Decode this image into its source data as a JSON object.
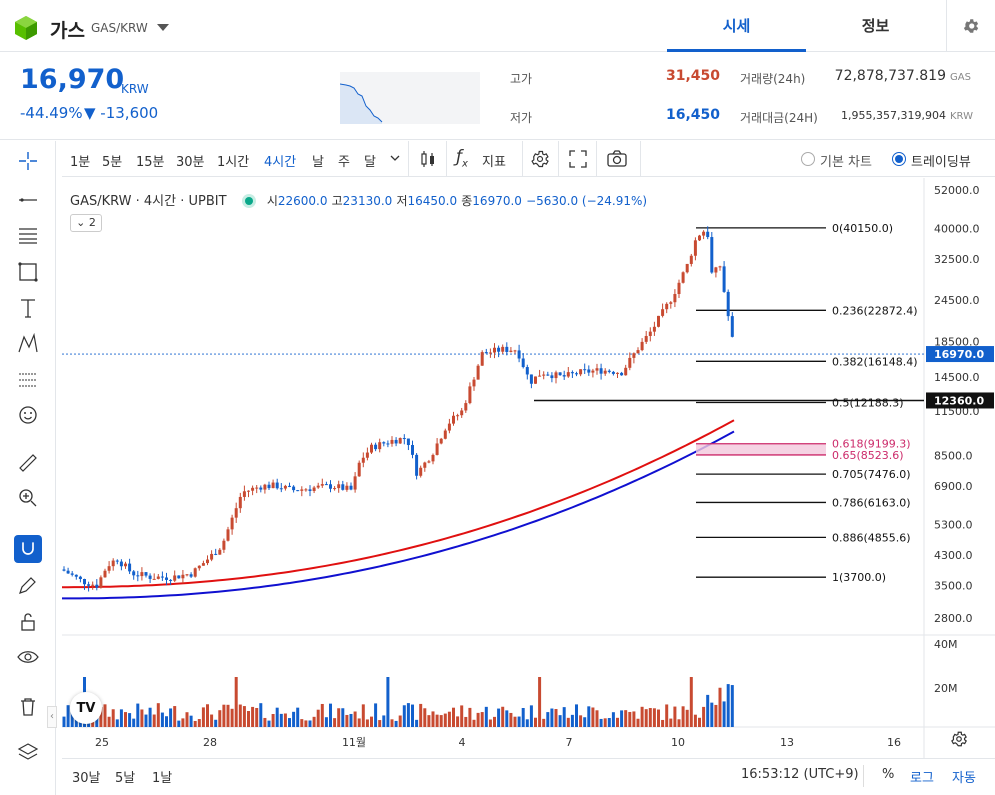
{
  "header": {
    "coin_name": "가스",
    "coin_pair": "GAS/KRW",
    "tabs": [
      "시세",
      "정보"
    ]
  },
  "summary": {
    "price": "16,970",
    "unit": "KRW",
    "change_pct": "-44.49%",
    "change_abs": "▼ -13,600",
    "high_label": "고가",
    "high_value": "31,450",
    "low_label": "저가",
    "low_value": "16,450",
    "volume_label": "거래량(24h)",
    "volume_value": "72,878,737.819",
    "volume_unit": "GAS",
    "amount_label": "거래대금(24H)",
    "amount_value": "1,955,357,319,904",
    "amount_unit": "KRW"
  },
  "toolbar": {
    "timeframes": [
      "1분",
      "5분",
      "15분",
      "30분",
      "1시간",
      "4시간",
      "날",
      "주",
      "달"
    ],
    "active_timeframe": "4시간",
    "indicator_label": "지표",
    "view_basic": "기본 차트",
    "view_tv": "트레이딩뷰"
  },
  "legend": {
    "symbol": "GAS/KRW · 4시간 · UPBIT",
    "o_label": "시",
    "o": "22600.0",
    "h_label": "고",
    "h": "23130.0",
    "l_label": "저",
    "l": "16450.0",
    "c_label": "종",
    "c": "16970.0",
    "chg": "−5630.0 (−24.91%)",
    "collapse": "2"
  },
  "colors": {
    "up": "#c84a31",
    "down": "#1260cc",
    "ma_red": "#e01010",
    "ma_blue": "#1010d0"
  },
  "chart_data": {
    "type": "candlestick",
    "price_axis": [
      "52000.0",
      "40000.0",
      "32500.0",
      "24500.0",
      "18500.0",
      "14500.0",
      "11500.0",
      "8500.0",
      "6900.0",
      "5300.0",
      "4300.0",
      "3500.0",
      "2800.0"
    ],
    "price_axis_values": [
      52000,
      40000,
      32500,
      24500,
      18500,
      14500,
      11500,
      8500,
      6900,
      5300,
      4300,
      3500,
      2800
    ],
    "volume_axis": [
      "40M",
      "20M"
    ],
    "x_ticks": [
      "25",
      "28",
      "11월",
      "4",
      "7",
      "10",
      "13",
      "16"
    ],
    "current_price_label": "16970.0",
    "crosshair_price_label": "12360.0",
    "fib_levels": [
      {
        "label": "0(40150.0)",
        "value": 40150
      },
      {
        "label": "0.236(22872.4)",
        "value": 22872.4
      },
      {
        "label": "0.382(16148.4)",
        "value": 16148.4
      },
      {
        "label": "0.5(12188.3)",
        "value": 12188.3
      },
      {
        "label": "0.618(9199.3)",
        "value": 9199.3
      },
      {
        "label": "0.65(8523.6)",
        "value": 8523.6
      },
      {
        "label": "0.705(7476.0)",
        "value": 7476
      },
      {
        "label": "0.786(6163.0)",
        "value": 6163
      },
      {
        "label": "0.886(4855.6)",
        "value": 4855.6
      },
      {
        "label": "1(3700.0)",
        "value": 3700
      }
    ]
  },
  "footer": {
    "ranges": [
      "30날",
      "5날",
      "1날"
    ],
    "time": "16:53:12 (UTC+9)",
    "percent": "%",
    "log": "로그",
    "auto": "자동"
  }
}
